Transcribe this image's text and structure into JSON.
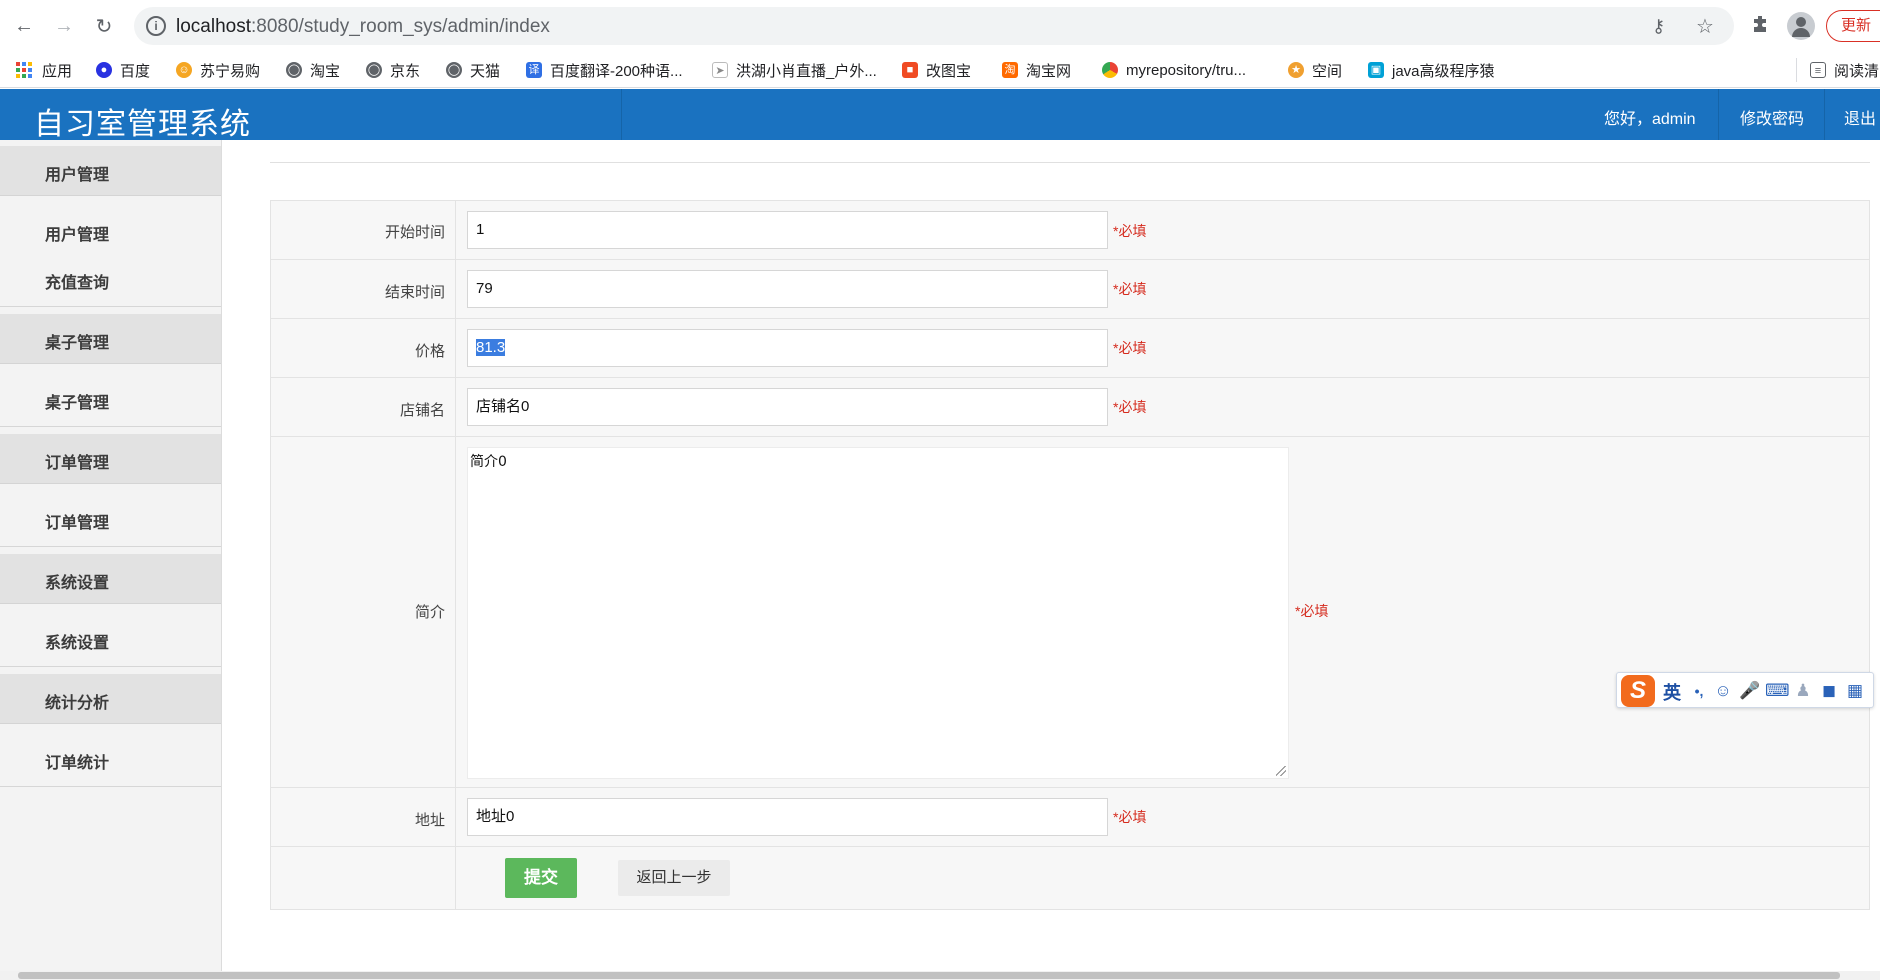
{
  "browser": {
    "url_host": "localhost",
    "url_rest": ":8080/study_room_sys/admin/index",
    "update_label": "更新",
    "bookmarks": [
      {
        "label": "应用",
        "icon": "apps-grid-icon"
      },
      {
        "label": "百度",
        "icon": "baidu-paw-icon",
        "color": "#2932e1"
      },
      {
        "label": "苏宁易购",
        "icon": "suning-icon",
        "color": "#f5a623"
      },
      {
        "label": "淘宝",
        "icon": "globe-icon",
        "color": "#5f6368"
      },
      {
        "label": "京东",
        "icon": "globe-icon",
        "color": "#5f6368"
      },
      {
        "label": "天猫",
        "icon": "globe-icon",
        "color": "#5f6368"
      },
      {
        "label": "百度翻译-200种语...",
        "icon": "translate-icon",
        "color": "#2f6fe4"
      },
      {
        "label": "洪湖小肖直播_户外...",
        "icon": "rocket-icon",
        "color": "#888888"
      },
      {
        "label": "改图宝",
        "icon": "gaitubao-icon",
        "color": "#f04b23"
      },
      {
        "label": "淘宝网",
        "icon": "taobao-icon",
        "color": "#ff6a00"
      },
      {
        "label": "myrepository/tru...",
        "icon": "chrome-icon",
        "color": "#34a853"
      },
      {
        "label": "空间",
        "icon": "qzone-icon",
        "color": "#f0a030"
      },
      {
        "label": "java高级程序猿",
        "icon": "bilibili-icon",
        "color": "#00a1d6"
      },
      {
        "label": "阅读清",
        "icon": "reading-list-icon",
        "color": "#5f6368"
      }
    ]
  },
  "header": {
    "title": "自习室管理系统",
    "greeting": "您好，admin",
    "change_password": "修改密码",
    "logout": "退出"
  },
  "sidebar": {
    "groups": [
      {
        "label": "用户管理",
        "items": [
          "用户管理",
          "充值查询"
        ]
      },
      {
        "label": "桌子管理",
        "items": [
          "桌子管理"
        ]
      },
      {
        "label": "订单管理",
        "items": [
          "订单管理"
        ]
      },
      {
        "label": "系统设置",
        "items": [
          "系统设置"
        ]
      },
      {
        "label": "统计分析",
        "items": [
          "订单统计"
        ]
      }
    ]
  },
  "form": {
    "required_mark": "*必填",
    "fields": {
      "start_time": {
        "label": "开始时间",
        "value": "1"
      },
      "end_time": {
        "label": "结束时间",
        "value": "79"
      },
      "price": {
        "label": "价格",
        "value": "81.3"
      },
      "shop_name": {
        "label": "店铺名",
        "value": "店铺名0"
      },
      "intro": {
        "label": "简介",
        "value": "简介0"
      },
      "address": {
        "label": "地址",
        "value": "地址0"
      }
    },
    "submit_label": "提交",
    "back_label": "返回上一步"
  },
  "ime": {
    "mode": "英",
    "punct": "•,",
    "accent": "#f26b1d"
  }
}
